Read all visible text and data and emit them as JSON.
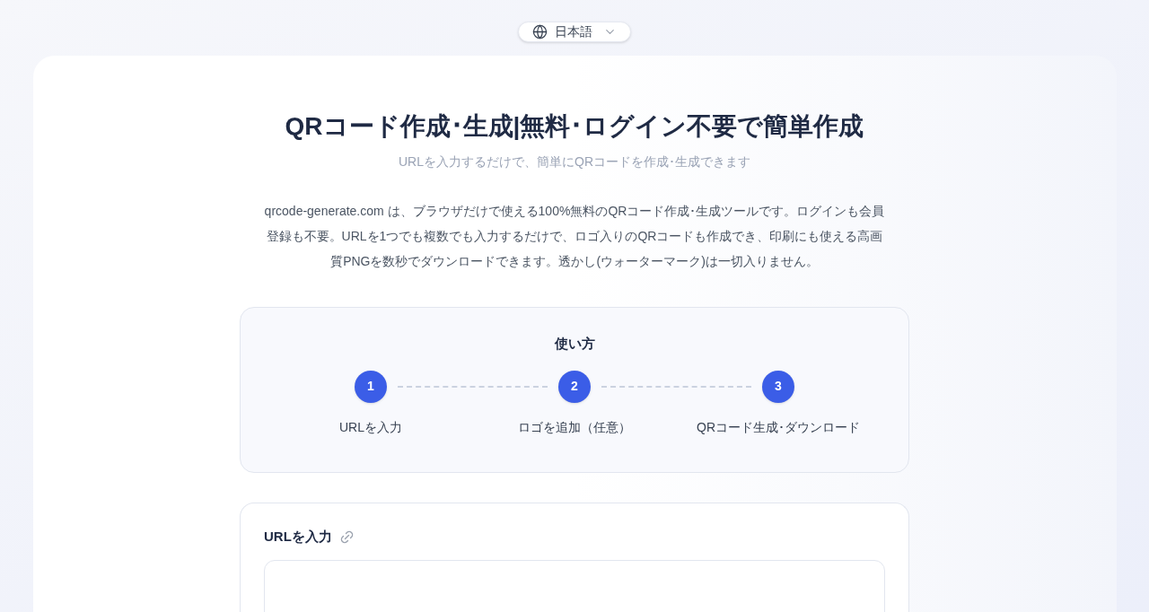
{
  "language_button": {
    "label": "日本語"
  },
  "title": "QRコード作成･生成|無料･ログイン不要で簡単作成",
  "subtitle": "URLを入力するだけで、簡単にQRコードを作成･生成できます",
  "description": "qrcode-generate.com は、ブラウザだけで使える100%無料のQRコード作成･生成ツールです。ログインも会員登録も不要。URLを1つでも複数でも入力するだけで、ロゴ入りのQRコードも作成でき、印刷にも使える高画質PNGを数秒でダウンロードできます。透かし(ウォーターマーク)は一切入りません。",
  "how_to": {
    "title": "使い方",
    "steps": [
      {
        "number": "1",
        "label": "URLを入力"
      },
      {
        "number": "2",
        "label": "ロゴを追加（任意）"
      },
      {
        "number": "3",
        "label": "QRコード生成･ダウンロード"
      }
    ]
  },
  "url_input": {
    "title": "URLを入力"
  }
}
